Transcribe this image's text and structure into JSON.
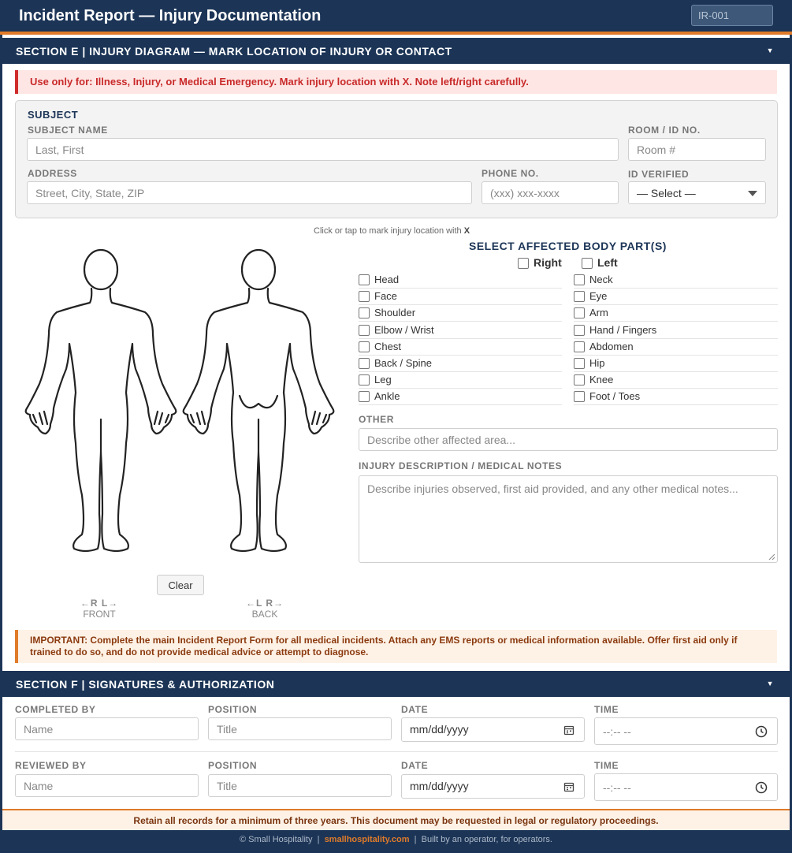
{
  "header": {
    "title": "Incident Report — Injury Documentation",
    "report_id": "IR-001"
  },
  "section_e": {
    "title": "SECTION E | INJURY DIAGRAM — MARK LOCATION OF INJURY OR CONTACT",
    "caret": "▼",
    "alert": "Use only for: Illness, Injury, or Medical Emergency. Mark injury location with X. Note left/right carefully.",
    "subject": {
      "heading": "SUBJECT",
      "name_label": "SUBJECT NAME",
      "name_placeholder": "Last, First",
      "room_label": "ROOM / ID NO.",
      "room_placeholder": "Room #",
      "address_label": "ADDRESS",
      "address_placeholder": "Street, City, State, ZIP",
      "phone_label": "PHONE NO.",
      "phone_placeholder": "(xxx) xxx-xxxx",
      "id_label": "ID VERIFIED",
      "id_selected": "— Select —"
    },
    "hint_prefix": "Click or tap to mark injury location with ",
    "hint_mark": "X",
    "clear_label": "Clear",
    "front": {
      "dir": "←R   L→",
      "label": "FRONT"
    },
    "back": {
      "dir": "←L   R→",
      "label": "BACK"
    },
    "parts_title": "SELECT AFFECTED BODY PART(S)",
    "side_right": "Right",
    "side_left": "Left",
    "parts_left": [
      "Head",
      "Face",
      "Shoulder",
      "Elbow / Wrist",
      "Chest",
      "Back / Spine",
      "Leg",
      "Ankle"
    ],
    "parts_right": [
      "Neck",
      "Eye",
      "Arm",
      "Hand / Fingers",
      "Abdomen",
      "Hip",
      "Knee",
      "Foot / Toes"
    ],
    "other_label": "OTHER",
    "other_placeholder": "Describe other affected area...",
    "notes_label": "INJURY DESCRIPTION / MEDICAL NOTES",
    "notes_placeholder": "Describe injuries observed, first aid provided, and any other medical notes...",
    "important": "IMPORTANT: Complete the main Incident Report Form for all medical incidents. Attach any EMS reports or medical information available. Offer first aid only if trained to do so, and do not provide medical advice or attempt to diagnose."
  },
  "section_f": {
    "title": "SECTION F | SIGNATURES & AUTHORIZATION",
    "caret": "▼",
    "completed_label": "COMPLETED BY",
    "reviewed_label": "REVIEWED BY",
    "position_label": "POSITION",
    "date_label": "DATE",
    "time_label": "TIME",
    "name_placeholder": "Name",
    "title_placeholder": "Title",
    "date_placeholder": "mm/dd/yyyy",
    "time_placeholder": "--:-- --"
  },
  "retain_notice": "Retain all records for a minimum of three years. This document may be requested in legal or regulatory proceedings.",
  "footer": {
    "left": "© Small Hospitality  |  ",
    "link": "smallhospitality.com",
    "right": "  |  Built by an operator, for operators."
  }
}
